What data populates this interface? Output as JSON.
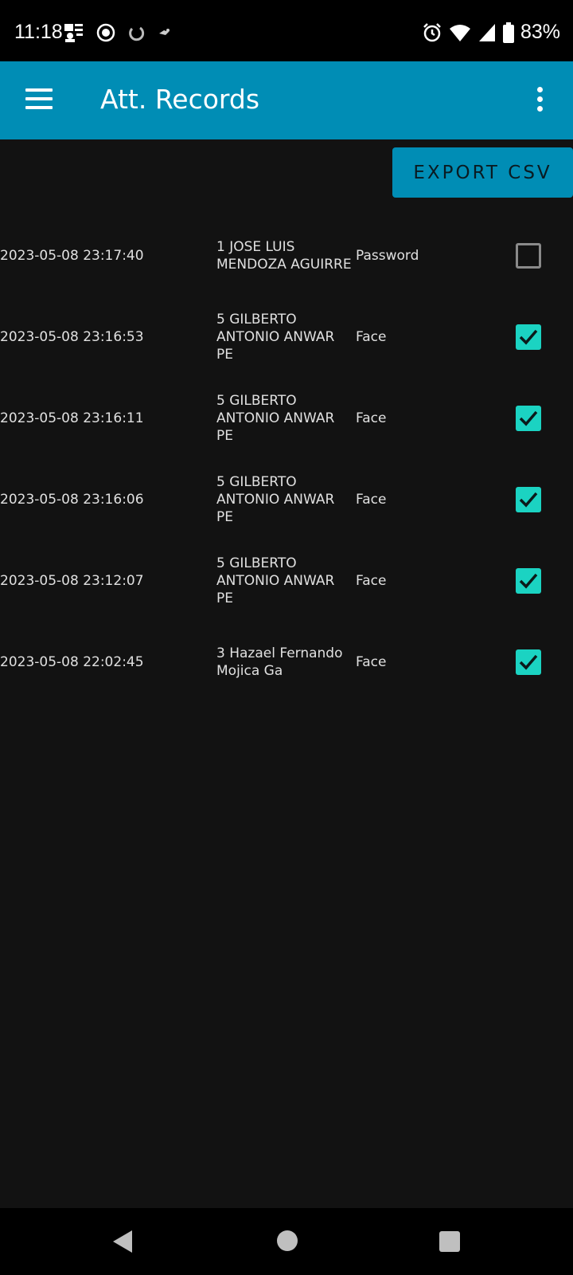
{
  "status_bar": {
    "time": "11:18",
    "battery": "83%",
    "icons": [
      "notification-photo-icon",
      "screen-record-icon",
      "sync-icon",
      "bird-icon",
      "alarm-icon",
      "wifi-icon",
      "signal-icon",
      "battery-icon"
    ]
  },
  "app_bar": {
    "title": "Att. Records",
    "menu_icon": "hamburger-menu-icon",
    "overflow_icon": "more-vertical-icon",
    "background_color": "#008DB5"
  },
  "toolbar": {
    "export_label": "EXPORT CSV"
  },
  "records": [
    {
      "timestamp": "2023-05-08 23:17:40",
      "name_lines": [
        "1 JOSE LUIS",
        "MENDOZA AGUIRRE"
      ],
      "method": "Password",
      "checked": false
    },
    {
      "timestamp": "2023-05-08 23:16:53",
      "name_lines": [
        "5 GILBERTO",
        "ANTONIO ANWAR",
        "PE"
      ],
      "method": "Face",
      "checked": true
    },
    {
      "timestamp": "2023-05-08 23:16:11",
      "name_lines": [
        "5 GILBERTO",
        "ANTONIO ANWAR",
        "PE"
      ],
      "method": "Face",
      "checked": true
    },
    {
      "timestamp": "2023-05-08 23:16:06",
      "name_lines": [
        "5 GILBERTO",
        "ANTONIO ANWAR",
        "PE"
      ],
      "method": "Face",
      "checked": true
    },
    {
      "timestamp": "2023-05-08 23:12:07",
      "name_lines": [
        "5 GILBERTO",
        "ANTONIO ANWAR",
        "PE"
      ],
      "method": "Face",
      "checked": true
    },
    {
      "timestamp": "2023-05-08 22:02:45",
      "name_lines": [
        "3 Hazael Fernando",
        "Mojica Ga"
      ],
      "method": "Face",
      "checked": true
    }
  ],
  "colors": {
    "accent": "#008DB5",
    "checkbox_checked": "#1BD3C2",
    "background": "#121212"
  },
  "nav_bar": {
    "icons": [
      "back-icon",
      "home-icon",
      "recents-icon"
    ]
  }
}
